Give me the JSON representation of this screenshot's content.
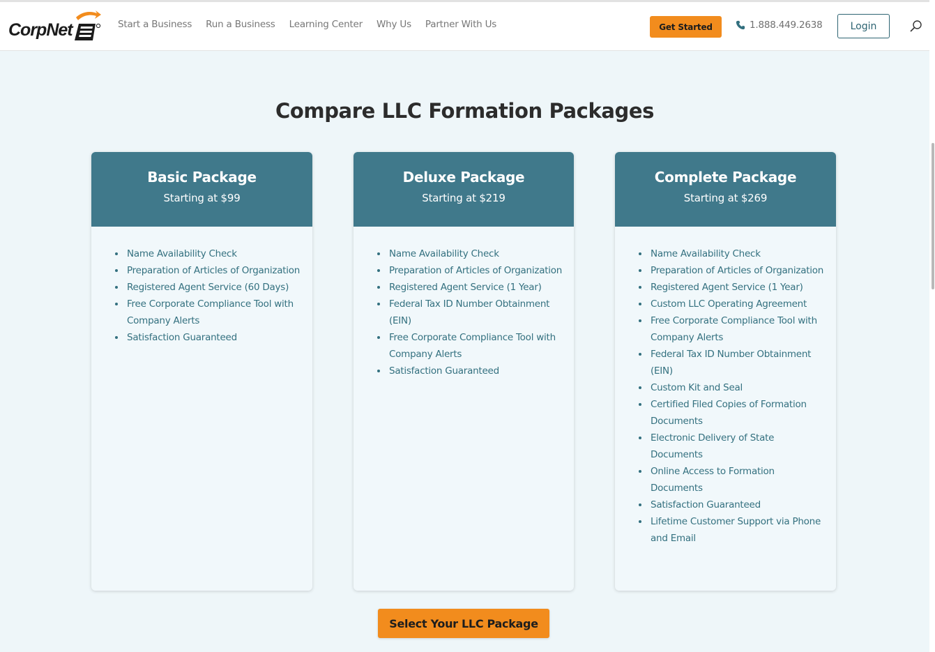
{
  "header": {
    "logo_text": "CorpNet",
    "nav": [
      "Start a Business",
      "Run a Business",
      "Learning Center",
      "Why Us",
      "Partner With Us"
    ],
    "get_started_label": "Get Started",
    "phone": "1.888.449.2638",
    "login_label": "Login",
    "accent_color": "#f28c1d",
    "brand_color": "#40798b"
  },
  "main": {
    "title": "Compare LLC Formation Packages",
    "packages": [
      {
        "name": "Basic Package",
        "price": "Starting at $99",
        "features": [
          "Name Availability Check",
          "Preparation of Articles of Organization",
          "Registered Agent Service (60 Days)",
          "Free Corporate Compliance Tool with Company Alerts",
          "Satisfaction Guaranteed"
        ]
      },
      {
        "name": "Deluxe Package",
        "price": "Starting at $219",
        "features": [
          "Name Availability Check",
          "Preparation of Articles of Organization",
          "Registered Agent Service (1 Year)",
          "Federal Tax ID Number Obtainment (EIN)",
          "Free Corporate Compliance Tool with Company Alerts",
          "Satisfaction Guaranteed"
        ]
      },
      {
        "name": "Complete Package",
        "price": "Starting at $269",
        "features": [
          "Name Availability Check",
          "Preparation of Articles of Organization",
          "Registered Agent Service (1 Year)",
          "Custom LLC Operating Agreement",
          "Free Corporate Compliance Tool with Company Alerts",
          "Federal Tax ID Number Obtainment (EIN)",
          "Custom Kit and Seal",
          "Certified Filed Copies of Formation Documents",
          "Electronic Delivery of State Documents",
          "Online Access to Formation Documents",
          "Satisfaction Guaranteed",
          "Lifetime Customer Support via Phone and Email"
        ]
      }
    ],
    "cta_label": "Select Your LLC Package"
  }
}
